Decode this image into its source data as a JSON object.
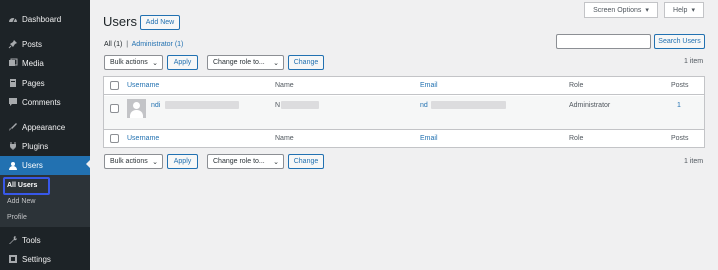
{
  "sidebar": {
    "items": [
      {
        "label": "Dashboard",
        "icon": "dashboard-icon"
      },
      {
        "label": "Posts",
        "icon": "pin-icon"
      },
      {
        "label": "Media",
        "icon": "media-icon"
      },
      {
        "label": "Pages",
        "icon": "pages-icon"
      },
      {
        "label": "Comments",
        "icon": "comments-icon"
      },
      {
        "label": "Appearance",
        "icon": "appearance-icon"
      },
      {
        "label": "Plugins",
        "icon": "plugins-icon"
      },
      {
        "label": "Users",
        "icon": "users-icon"
      },
      {
        "label": "Tools",
        "icon": "tools-icon"
      },
      {
        "label": "Settings",
        "icon": "settings-icon"
      }
    ],
    "submenu": [
      "All Users",
      "Add New",
      "Profile"
    ]
  },
  "header": {
    "title": "Users",
    "add_new": "Add New",
    "screen_options": "Screen Options",
    "help": "Help"
  },
  "filters": {
    "all": "All",
    "all_count": "(1)",
    "separator": "|",
    "admin": "Administrator",
    "admin_count": "(1)"
  },
  "search": {
    "button": "Search Users",
    "value": ""
  },
  "toolbar": {
    "bulk_actions": "Bulk actions",
    "apply": "Apply",
    "change_role": "Change role to...",
    "change": "Change",
    "item_count": "1 item"
  },
  "table": {
    "columns": [
      "Username",
      "Name",
      "Email",
      "Role",
      "Posts"
    ],
    "rows": [
      {
        "username": "ndi",
        "name": "N",
        "email": "nd",
        "role": "Administrator",
        "posts": "1"
      }
    ]
  },
  "colors": {
    "sidebar_bg": "#1d2327",
    "accent": "#2271b1",
    "highlight": "#3858e9"
  }
}
